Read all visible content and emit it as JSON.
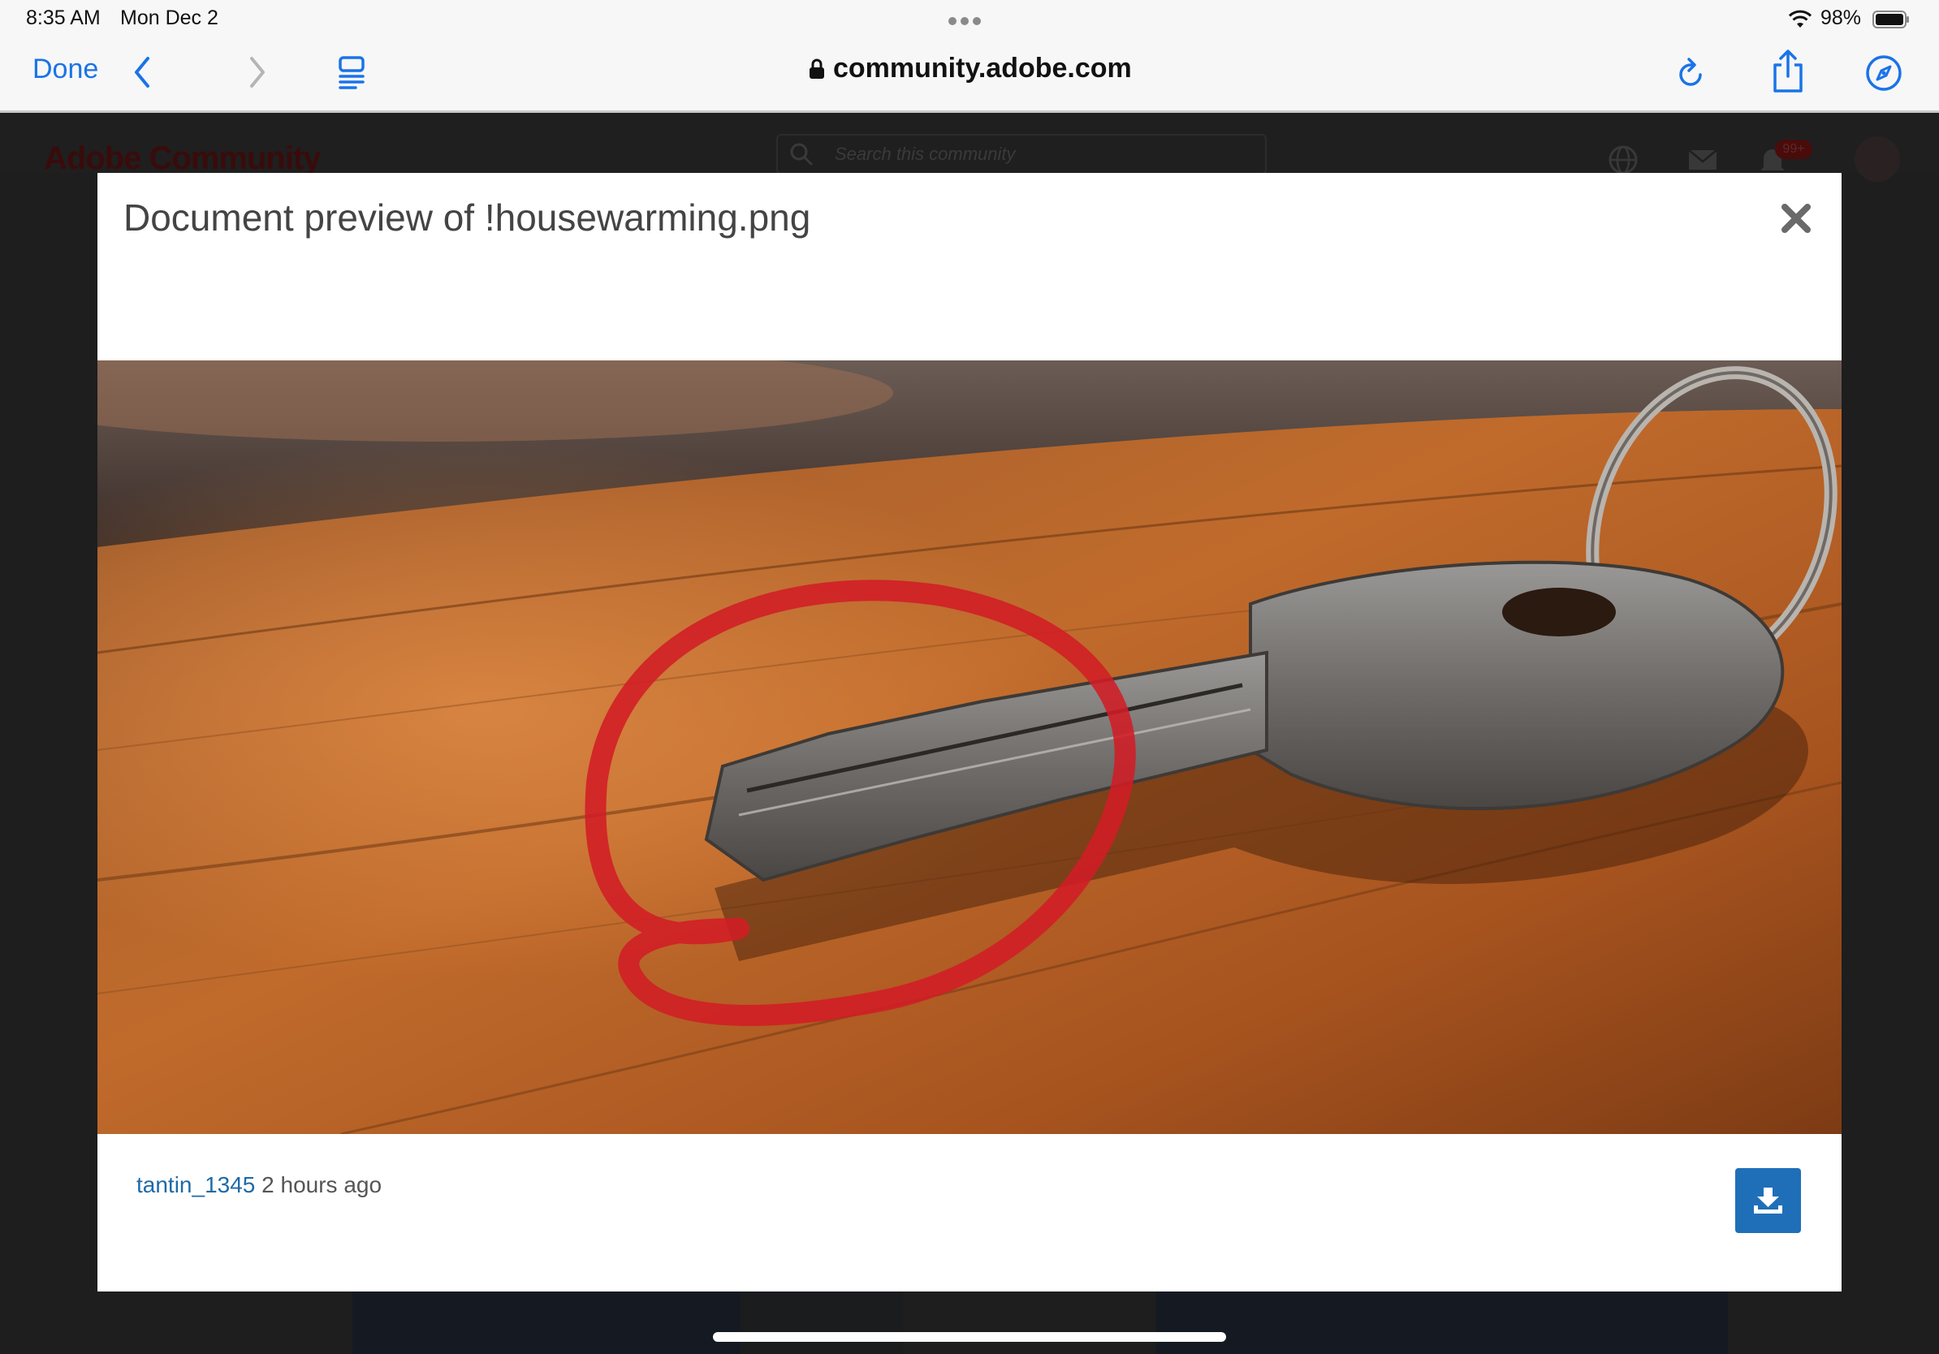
{
  "status_bar": {
    "time": "8:35 AM",
    "date": "Mon Dec 2",
    "battery": "98%"
  },
  "browser": {
    "done_label": "Done",
    "url": "community.adobe.com",
    "icons": [
      "chevron-left-icon",
      "chevron-right-icon",
      "tabs-icon",
      "reload-icon",
      "share-icon",
      "compass-icon",
      "lock-icon"
    ]
  },
  "background_page": {
    "logo": "Adobe Community",
    "search_placeholder": "Search this community",
    "notification_badge": "99+"
  },
  "modal": {
    "title": "Document preview of !housewarming.png",
    "author": "tantin_1345",
    "time_ago": "2 hours ago",
    "icons": [
      "close-icon",
      "download-icon"
    ]
  },
  "colors": {
    "accent": "#1a73e8",
    "download_button": "#1f6fb8",
    "username_link": "#1e6aa8",
    "annotation_circle": "#d21c26"
  }
}
